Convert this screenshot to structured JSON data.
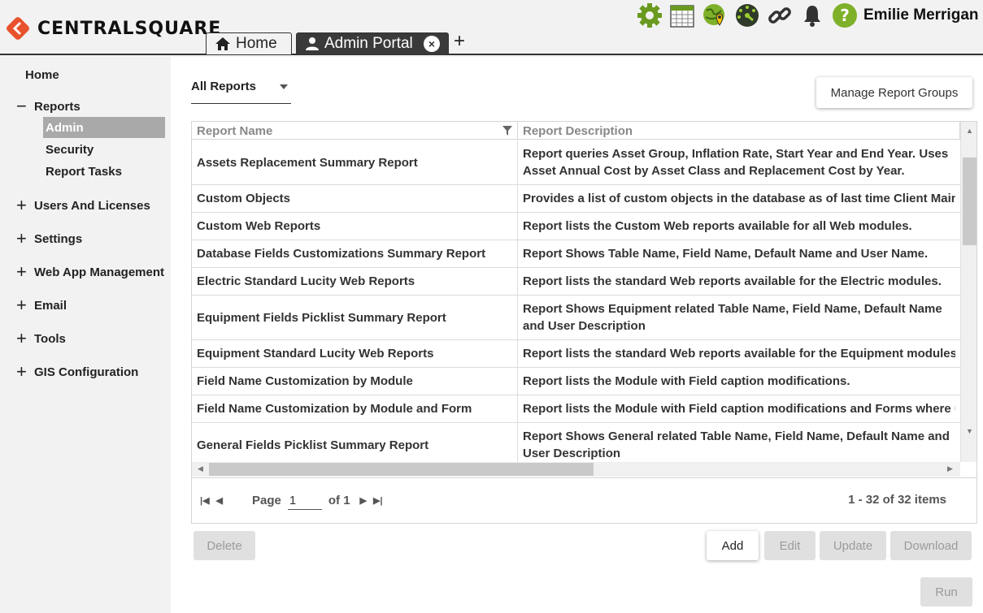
{
  "brand": {
    "name": "CENTRALSQUARE",
    "accent": "#e8522c"
  },
  "tabs": [
    {
      "label": "Home",
      "icon": "home-icon"
    },
    {
      "label": "Admin Portal",
      "icon": "user-icon",
      "close": "×"
    }
  ],
  "tab_add": "+",
  "toolbar": {
    "icons": [
      "gear-icon",
      "calendar-icon",
      "map-pin-globe-icon",
      "dashboard-icon",
      "link-icon",
      "bell-icon",
      "help-icon"
    ]
  },
  "user": {
    "name": "Emilie Merrigan"
  },
  "sidebar": {
    "home": "Home",
    "reports": {
      "sign": "−",
      "label": "Reports",
      "children": [
        "Admin",
        "Security",
        "Report Tasks"
      ]
    },
    "sections": [
      {
        "sign": "+",
        "label": "Users And Licenses"
      },
      {
        "sign": "+",
        "label": "Settings"
      },
      {
        "sign": "+",
        "label": "Web App Management"
      },
      {
        "sign": "+",
        "label": "Email"
      },
      {
        "sign": "+",
        "label": "Tools"
      },
      {
        "sign": "+",
        "label": "GIS Configuration"
      }
    ]
  },
  "main": {
    "filter_value": "All Reports",
    "manage_button": "Manage Report Groups",
    "grid": {
      "columns": [
        "Report Name",
        "Report Description"
      ],
      "rows": [
        {
          "name": "Assets Replacement Summary Report",
          "desc": "Report queries Asset Group, Inflation Rate, Start Year and End Year. Uses Asset Annual Cost by Asset Class and Replacement Cost by Year."
        },
        {
          "name": "Custom Objects",
          "desc": "Provides a list of custom objects in the database as of last time Client Maintenance was run."
        },
        {
          "name": "Custom Web Reports",
          "desc": "Report lists the Custom Web reports available for all Web modules."
        },
        {
          "name": "Database Fields Customizations Summary Report",
          "desc": "Report Shows Table Name, Field Name, Default Name and User Name."
        },
        {
          "name": "Electric Standard Lucity Web Reports",
          "desc": "Report lists the standard Web reports available for the Electric modules."
        },
        {
          "name": "Equipment Fields Picklist Summary Report",
          "desc": "Report Shows Equipment related Table Name, Field Name, Default Name and User Description"
        },
        {
          "name": "Equipment Standard Lucity Web Reports",
          "desc": "Report lists the standard Web reports available for the Equipment modules."
        },
        {
          "name": "Field Name Customization by Module",
          "desc": "Report lists the Module with Field caption modifications."
        },
        {
          "name": "Field Name Customization by Module and Form",
          "desc": "Report lists the Module with Field caption modifications and Forms where used."
        },
        {
          "name": "General Fields Picklist Summary Report",
          "desc": "Report Shows General related Table Name, Field Name, Default Name and User Description"
        }
      ]
    },
    "pager": {
      "page_label": "Page",
      "page_value": "1",
      "of_label": "of 1",
      "items": "1 - 32 of 32 items"
    },
    "buttons": {
      "delete": "Delete",
      "add": "Add",
      "edit": "Edit",
      "update": "Update",
      "download": "Download",
      "run": "Run"
    }
  }
}
